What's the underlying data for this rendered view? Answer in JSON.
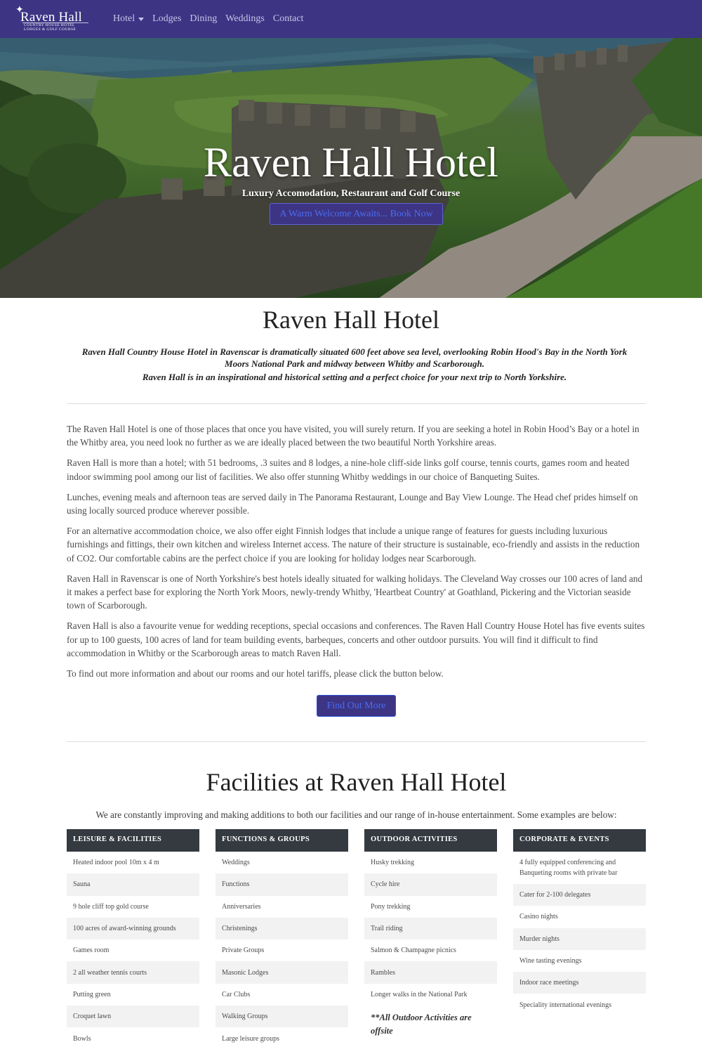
{
  "brand": {
    "title": "Raven Hall",
    "subtitle_line1": "COUNTRY HOUSE HOTEL",
    "subtitle_line2": "LODGES & GOLF COURSE"
  },
  "nav": {
    "items": [
      {
        "label": "Hotel",
        "dropdown": true
      },
      {
        "label": "Lodges"
      },
      {
        "label": "Dining"
      },
      {
        "label": "Weddings"
      },
      {
        "label": "Contact"
      }
    ]
  },
  "hero": {
    "title": "Raven Hall Hotel",
    "subtitle": "Luxury Accomodation, Restaurant and Golf Course",
    "button_label": "A Warm Welcome Awaits... Book Now"
  },
  "intro": {
    "title": "Raven Hall Hotel",
    "lead": "Raven Hall Country House Hotel in Ravenscar is dramatically situated 600 feet above sea level, overlooking Robin Hood's Bay in the North York Moors National Park and midway between Whitby and Scarborough.",
    "lead2": "Raven Hall is in an inspirational and historical setting and a perfect choice for your next trip to North Yorkshire.",
    "paragraphs": [
      "The Raven Hall Hotel is one of those places that once you have visited, you will surely return. If you are seeking a hotel in Robin Hood’s Bay or a hotel in the Whitby area, you need look no further as we are ideally placed between the two beautiful North Yorkshire areas.",
      "Raven Hall is more than a hotel; with 51 bedrooms, .3 suites and 8 lodges, a nine-hole cliff-side links golf course, tennis courts, games room and heated indoor swimming pool among our list of facilities. We also offer stunning Whitby weddings in our choice of Banqueting Suites.",
      "Lunches, evening meals and afternoon teas are served daily in The Panorama Restaurant, Lounge and Bay View Lounge. The Head chef prides himself on using locally sourced produce wherever possible.",
      "For an alternative accommodation choice, we also offer eight Finnish lodges that include a unique range of features for guests including luxurious furnishings and fittings, their own kitchen and wireless Internet access. The nature of their structure is sustainable, eco-friendly and assists in the reduction of CO2. Our comfortable cabins are the perfect choice if you are looking for holiday lodges near Scarborough.",
      "Raven Hall in Ravenscar is one of North Yorkshire's best hotels ideally situated for walking holidays. The Cleveland Way crosses our 100 acres of land and it makes a perfect base for exploring the North York Moors, newly-trendy Whitby, 'Heartbeat Country' at Goathland, Pickering and the Victorian seaside town of Scarborough.",
      "Raven Hall is also a favourite venue for wedding receptions, special occasions and conferences. The Raven Hall Country House Hotel has five events suites for up to 100 guests, 100 acres of land for team building events, barbeques, concerts and other outdoor pursuits. You will find it difficult to find accommodation in Whitby or the Scarborough areas to match Raven Hall.",
      "To find out more information and about our rooms and our hotel tariffs, please click the button below."
    ],
    "button_label": "Find Out More"
  },
  "facilities": {
    "title": "Facilities at Raven Hall Hotel",
    "intro": "We are constantly improving and making additions to both our facilities and our range of in-house entertainment. Some examples are below:",
    "columns": [
      {
        "heading": "LEISURE & FACILITIES",
        "items": [
          "Heated indoor pool 10m x 4 m",
          "Sauna",
          "9 hole cliff top gold course",
          "100 acres of award-winning grounds",
          "Games room",
          "2 all weather tennis courts",
          "Putting green",
          "Croquet lawn",
          "Bowls"
        ]
      },
      {
        "heading": "FUNCTIONS & GROUPS",
        "items": [
          "Weddings",
          "Functions",
          "Anniversaries",
          "Christenings",
          "Private Groups",
          "Masonic Lodges",
          "Car Clubs",
          "Walking Groups",
          "Large leisure groups"
        ]
      },
      {
        "heading": "OUTDOOR ACTIVITIES",
        "items": [
          "Husky trekking",
          "Cycle hire",
          "Pony trekking",
          "Trail riding",
          "Salmon & Champagne picnics",
          "Rambles",
          "Longer walks in the National Park"
        ],
        "note": "**All Outdoor Activities are offsite"
      },
      {
        "heading": "CORPORATE & EVENTS",
        "items": [
          "4 fully equipped conferencing and Banqueting rooms with private bar",
          "Cater for 2-100 delegates",
          "Casino nights",
          "Murder nights",
          "Wine tasting evenings",
          "Indoor race meetings",
          "Speciality international evenings"
        ]
      }
    ]
  },
  "colors": {
    "navbar": "#3d3484",
    "button_text": "#4a6df0",
    "table_header": "#343a40",
    "row_alt": "#f2f2f2"
  }
}
